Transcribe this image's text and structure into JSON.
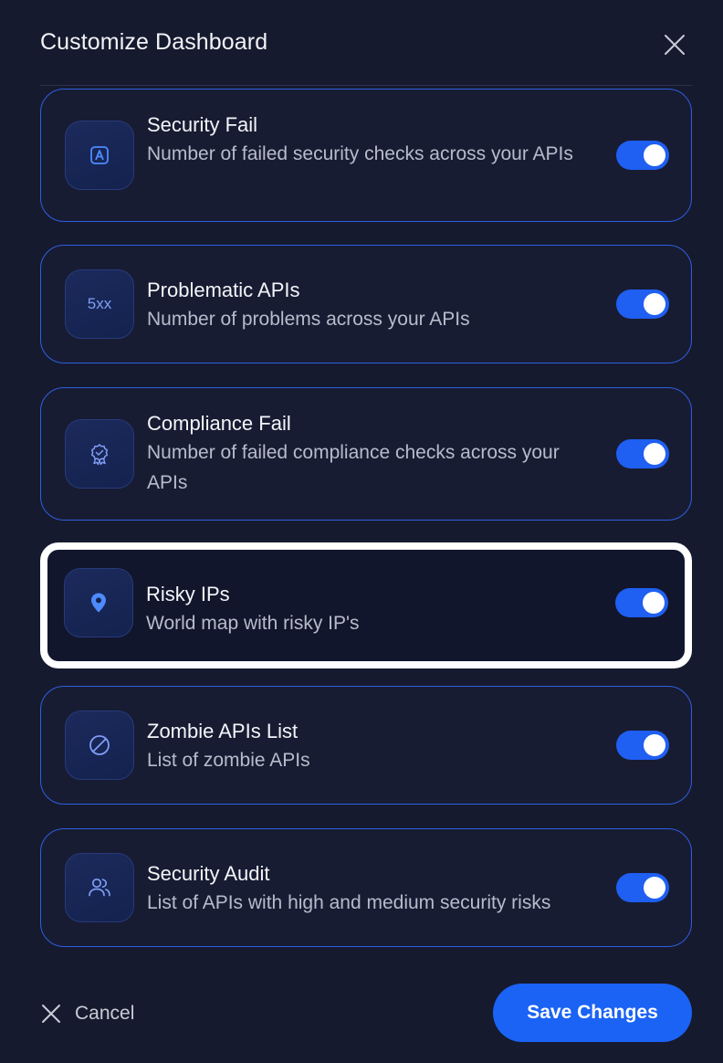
{
  "header": {
    "title": "Customize Dashboard"
  },
  "widgets": [
    {
      "title": "Security Fail",
      "description": "Number of failed security checks across your APIs",
      "icon": "shield-a-icon",
      "enabled": true
    },
    {
      "title": "Problematic APIs",
      "description": "Number of problems across your APIs",
      "icon": "5xx-icon",
      "icon_text": "5xx",
      "enabled": true
    },
    {
      "title": "Compliance Fail",
      "description": "Number of failed compliance checks across your APIs",
      "icon": "badge-icon",
      "enabled": true
    },
    {
      "title": "Risky IPs",
      "description": "World map with risky IP's",
      "icon": "location-pin-icon",
      "enabled": true
    },
    {
      "title": "Zombie APIs List",
      "description": "List of zombie APIs",
      "icon": "ban-icon",
      "enabled": true
    },
    {
      "title": "Security Audit",
      "description": "List of APIs with high and medium security risks",
      "icon": "users-icon",
      "enabled": true
    }
  ],
  "footer": {
    "cancel_label": "Cancel",
    "save_label": "Save Changes"
  },
  "colors": {
    "background": "#161a2e",
    "accent": "#1a63f5",
    "card_border": "#2f5ee0",
    "highlight_border": "#ffffff"
  }
}
